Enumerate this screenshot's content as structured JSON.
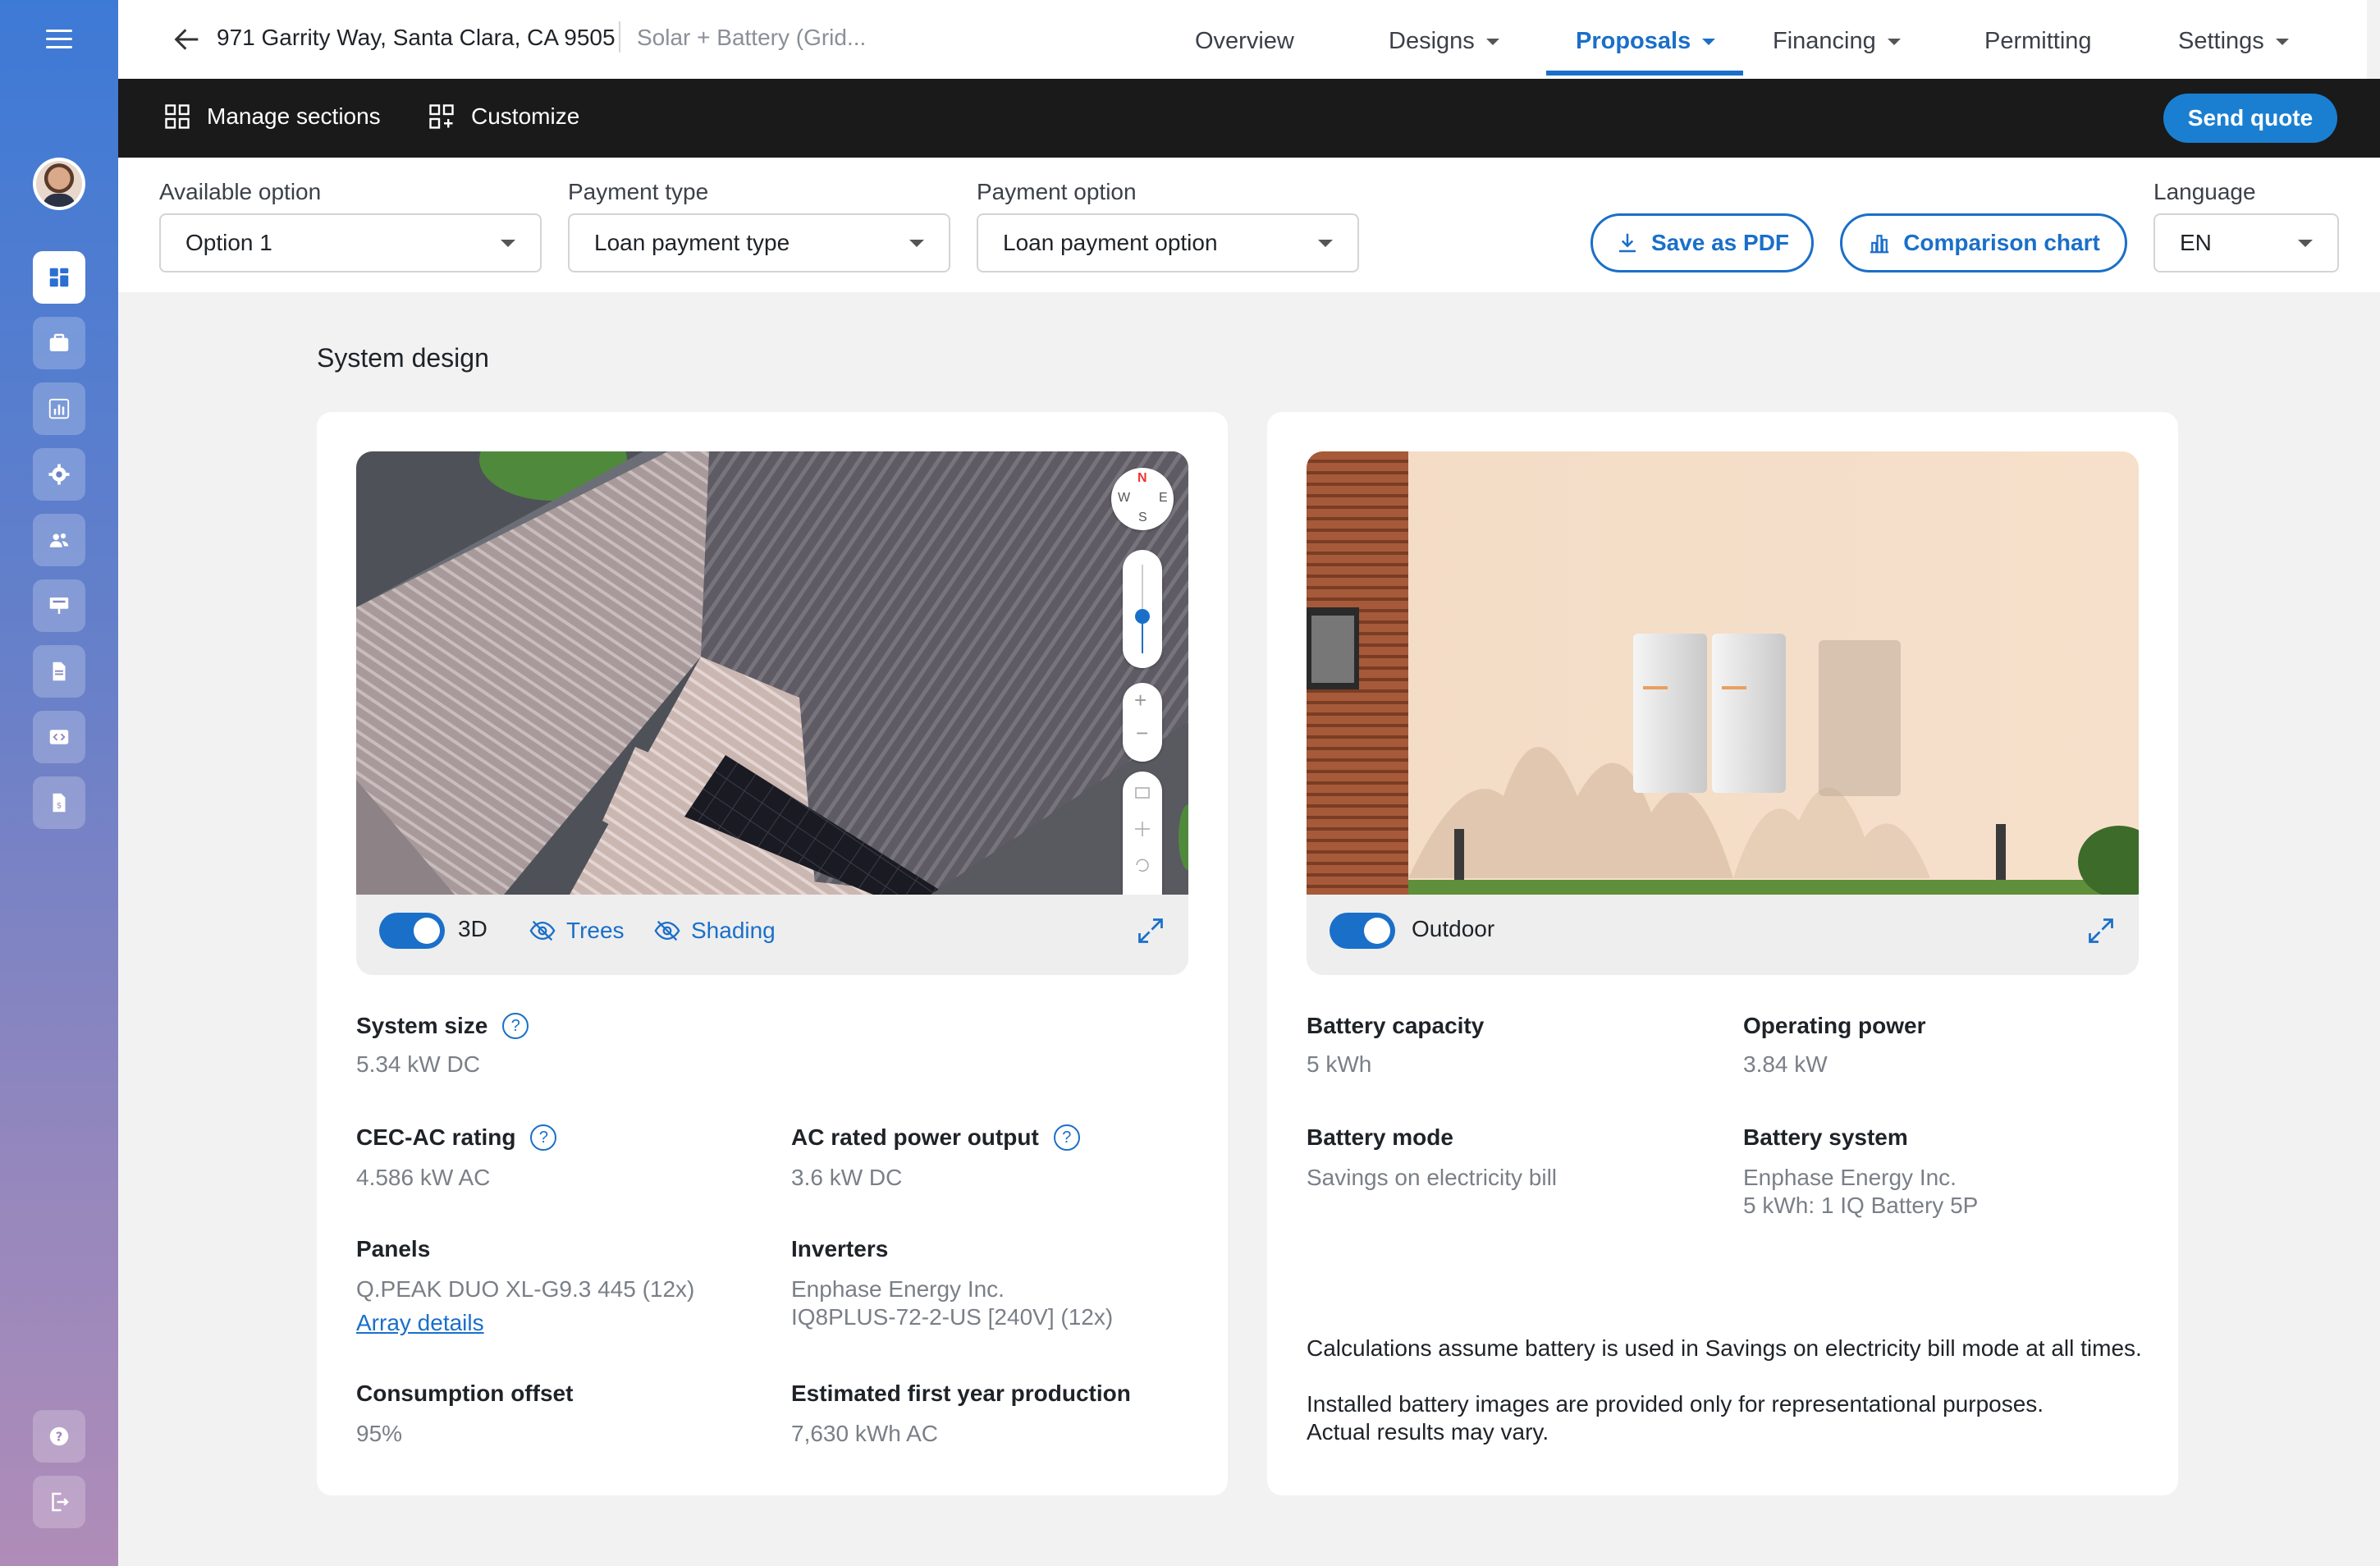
{
  "header": {
    "address": "971 Garrity Way, Santa Clara, CA 9505",
    "subtitle": "Solar + Battery (Grid...",
    "tabs": [
      {
        "label": "Overview"
      },
      {
        "label": "Designs"
      },
      {
        "label": "Proposals"
      },
      {
        "label": "Financing"
      },
      {
        "label": "Permitting"
      },
      {
        "label": "Settings"
      }
    ]
  },
  "toolbar": {
    "manage_sections": "Manage sections",
    "customize": "Customize",
    "send_quote": "Send quote"
  },
  "options": {
    "available_option_label": "Available option",
    "available_option_value": "Option 1",
    "payment_type_label": "Payment type",
    "payment_type_value": "Loan payment type",
    "payment_option_label": "Payment option",
    "payment_option_value": "Loan payment option",
    "save_pdf": "Save as PDF",
    "comparison_chart": "Comparison chart",
    "language_label": "Language",
    "language_value": "EN"
  },
  "section_title": "System design",
  "design_card": {
    "compass": {
      "n": "N",
      "w": "W",
      "e": "E",
      "s": "S"
    },
    "toggle_3d": "3D",
    "trees": "Trees",
    "shading": "Shading",
    "system_size_label": "System size",
    "system_size_value": "5.34 kW DC",
    "cec_label": "CEC-AC rating",
    "cec_value": "4.586 kW AC",
    "ac_rated_label": "AC rated power output",
    "ac_rated_value": "3.6 kW DC",
    "panels_label": "Panels",
    "panels_value": "Q.PEAK DUO XL-G9.3 445 (12x)",
    "array_details": "Array details",
    "inverters_label": "Inverters",
    "inverters_value_1": "Enphase Energy Inc.",
    "inverters_value_2": "IQ8PLUS-72-2-US [240V] (12x)",
    "consumption_label": "Consumption offset",
    "consumption_value": "95%",
    "production_label": "Estimated first year production",
    "production_value": "7,630 kWh AC"
  },
  "battery_card": {
    "toggle_outdoor": "Outdoor",
    "capacity_label": "Battery capacity",
    "capacity_value": "5 kWh",
    "power_label": "Operating power",
    "power_value": "3.84 kW",
    "mode_label": "Battery mode",
    "mode_value": "Savings on electricity bill",
    "system_label": "Battery system",
    "system_value_1": "Enphase Energy Inc.",
    "system_value_2": "5 kWh: 1 IQ Battery 5P",
    "note_1": "Calculations assume battery is used in Savings on electricity bill mode at all times.",
    "note_2": "Installed battery images are provided only for representational purposes.",
    "note_3": "Actual results may vary."
  },
  "colors": {
    "accent": "#1a6fc9",
    "toolbar": "#1a1a1a"
  }
}
